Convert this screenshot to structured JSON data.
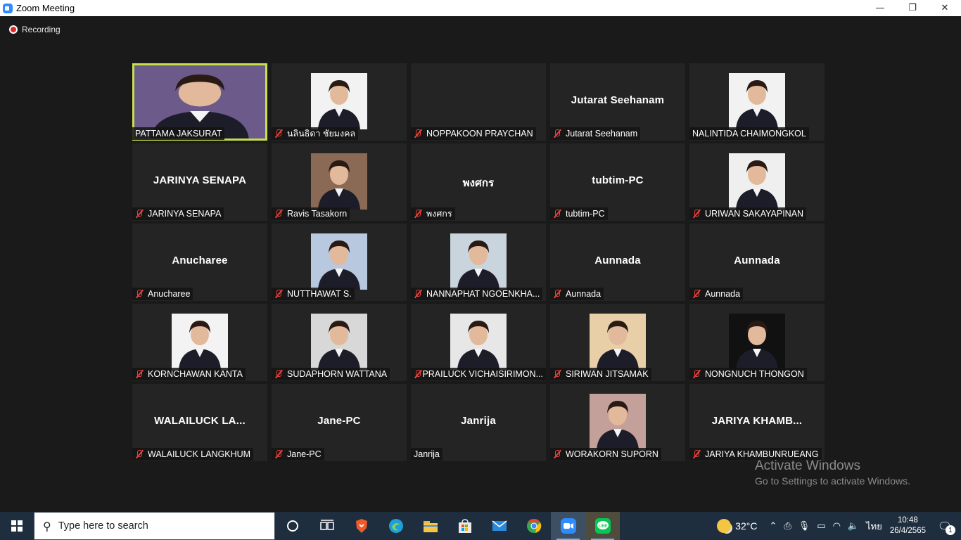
{
  "window": {
    "title": "Zoom Meeting",
    "controls": {
      "minimize": "—",
      "restore": "❐",
      "close": "✕"
    }
  },
  "recording": {
    "label": "Recording"
  },
  "participants": [
    {
      "display_name": "PATTAMA JAKSURAT",
      "label": "",
      "muted": false,
      "video": true,
      "active_speaker": true,
      "photo_bg": "#6b5a8a"
    },
    {
      "display_name": "นลินธิดา ชัยมงคล",
      "label": "",
      "muted": true,
      "video": true,
      "photo_bg": "#f2f2f2"
    },
    {
      "display_name": "NOPPAKOON PRAYCHAN",
      "label": "",
      "muted": true,
      "video": false
    },
    {
      "display_name": "Jutarat Seehanam",
      "label": "Jutarat Seehanam",
      "muted": true,
      "video": false
    },
    {
      "display_name": "NALINTIDA CHAIMONGKOL",
      "label": "",
      "muted": false,
      "video": true,
      "photo_bg": "#f2f2f2"
    },
    {
      "display_name": "JARINYA SENAPA",
      "label": "JARINYA SENAPA",
      "muted": true,
      "video": false
    },
    {
      "display_name": "Ravis Tasakorn",
      "label": "",
      "muted": true,
      "video": true,
      "photo_bg": "#8a6a55"
    },
    {
      "display_name": "พงศกร",
      "label": "พงศกร",
      "muted": true,
      "video": false
    },
    {
      "display_name": "tubtim-PC",
      "label": "tubtim-PC",
      "muted": true,
      "video": false
    },
    {
      "display_name": "URIWAN SAKAYAPINAN",
      "label": "",
      "muted": true,
      "video": true,
      "photo_bg": "#efefef"
    },
    {
      "display_name": "Anucharee",
      "label": "Anucharee",
      "muted": true,
      "video": false
    },
    {
      "display_name": "NUTTHAWAT S.",
      "label": "",
      "muted": true,
      "video": true,
      "photo_bg": "#b8c8de"
    },
    {
      "display_name": "NANNAPHAT NGOENKHA...",
      "label": "",
      "muted": true,
      "video": true,
      "photo_bg": "#c9d4dc"
    },
    {
      "display_name": "Aunnada",
      "label": "Aunnada",
      "muted": true,
      "video": false
    },
    {
      "display_name": "Aunnada",
      "label": "Aunnada",
      "muted": true,
      "video": false
    },
    {
      "display_name": "KORNCHAWAN KANTA",
      "label": "",
      "muted": true,
      "video": true,
      "photo_bg": "#f3f3f3"
    },
    {
      "display_name": "SUDAPHORN WATTANA",
      "label": "",
      "muted": true,
      "video": true,
      "photo_bg": "#d8d8d8"
    },
    {
      "display_name": "PRAILUCK VICHAISIRIMON...",
      "label": "",
      "muted": true,
      "video": true,
      "photo_bg": "#e7e7e7"
    },
    {
      "display_name": "SIRIWAN JITSAMAK",
      "label": "",
      "muted": true,
      "video": true,
      "photo_bg": "#e8cfa8"
    },
    {
      "display_name": "NONGNUCH THONGON",
      "label": "",
      "muted": true,
      "video": true,
      "photo_bg": "#111111"
    },
    {
      "display_name": "WALAILUCK LANGKHUM",
      "label": "WALAILUCK LA...",
      "muted": true,
      "video": false
    },
    {
      "display_name": "Jane-PC",
      "label": "Jane-PC",
      "muted": true,
      "video": false
    },
    {
      "display_name": "Janrija",
      "label": "Janrija",
      "muted": false,
      "video": false
    },
    {
      "display_name": "WORAKORN SUPORN",
      "label": "",
      "muted": true,
      "video": true,
      "photo_bg": "#c4a09a"
    },
    {
      "display_name": "JARIYA KHAMBUNRUEANG",
      "label": "JARIYA KHAMB...",
      "muted": true,
      "video": false
    }
  ],
  "watermark": {
    "title": "Activate Windows",
    "subtitle": "Go to Settings to activate Windows."
  },
  "taskbar": {
    "search_placeholder": "Type here to search",
    "apps": [
      {
        "name": "task-view",
        "glyph": "⧉"
      },
      {
        "name": "brave",
        "glyph": "",
        "color": "#f05a28"
      },
      {
        "name": "edge",
        "glyph": "e",
        "color": "#1f9ed8"
      },
      {
        "name": "file-explorer",
        "glyph": "",
        "color": "#f5c543"
      },
      {
        "name": "microsoft-store",
        "glyph": "",
        "color": "#2b88d8"
      },
      {
        "name": "mail",
        "glyph": "✉",
        "color": "#2b88d8"
      },
      {
        "name": "chrome",
        "glyph": "",
        "color": "#34a853"
      },
      {
        "name": "zoom",
        "glyph": "",
        "color": "#2d8cff"
      },
      {
        "name": "line",
        "glyph": "LINE",
        "color": "#06c755"
      }
    ],
    "weather": {
      "temp": "32°C"
    },
    "language": "ไทย",
    "clock": {
      "time": "10:48",
      "date": "26/4/2565"
    },
    "notifications": {
      "count": "1"
    }
  }
}
